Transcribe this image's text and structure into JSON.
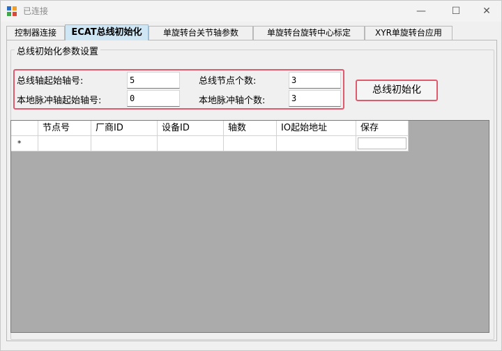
{
  "window": {
    "title": "已连接",
    "minimize_glyph": "—",
    "maximize_glyph": "☐",
    "close_glyph": "✕"
  },
  "tabs": [
    {
      "label": "控制器连接",
      "active": false
    },
    {
      "label": "ECAT总线初始化",
      "active": true
    },
    {
      "label": "单旋转台关节轴参数",
      "active": false
    },
    {
      "label": "单旋转台旋转中心标定",
      "active": false
    },
    {
      "label": "XYR单旋转台应用",
      "active": false
    }
  ],
  "group": {
    "title": "总线初始化参数设置"
  },
  "params": {
    "bus_start_axis_label": "总线轴起始轴号:",
    "bus_start_axis_value": "5",
    "node_count_label": "总线节点个数:",
    "node_count_value": "3",
    "local_pulse_start_label": "本地脉冲轴起始轴号:",
    "local_pulse_start_value": "0",
    "local_pulse_count_label": "本地脉冲轴个数:",
    "local_pulse_count_value": "3"
  },
  "init_button": {
    "label": "总线初始化"
  },
  "grid": {
    "columns": [
      "节点号",
      "厂商ID",
      "设备ID",
      "轴数",
      "IO起始地址",
      "保存"
    ],
    "new_row_marker": "*"
  },
  "colors": {
    "highlight_border": "#e05a6d",
    "active_tab": "#cfe6f5",
    "grid_background": "#ababab"
  },
  "icons": {
    "app": "app-window-icon"
  }
}
